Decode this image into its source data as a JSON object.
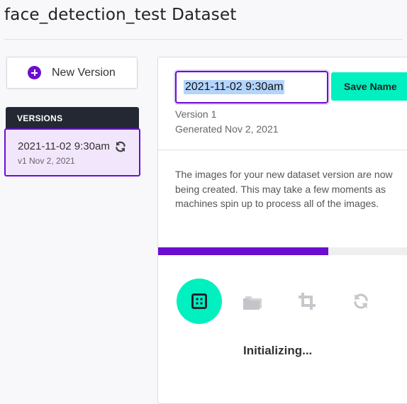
{
  "header": {
    "title": "face_detection_test Dataset"
  },
  "sidebar": {
    "new_version_button": {
      "label": "New Version",
      "icon": "plus-circle-icon"
    },
    "versions_header": "VERSIONS",
    "versions": [
      {
        "name": "2021-11-02 9:30am",
        "meta": "v1 Nov 2, 2021",
        "icon": "sync-icon",
        "selected": true
      }
    ]
  },
  "main": {
    "name_input": {
      "value": "2021-11-02 9:30am"
    },
    "save_name_button": "Save Name",
    "version_label": "Version 1",
    "generated_label": "Generated Nov 2, 2021",
    "description": "The images for your new dataset version are now being created. This may take a few moments as machines spin up to process all of the images.",
    "progress_fraction": 0.67,
    "steps": [
      {
        "icon": "grid-icon",
        "active": true
      },
      {
        "icon": "folder-icon",
        "active": false
      },
      {
        "icon": "crop-icon",
        "active": false
      },
      {
        "icon": "sync-icon",
        "active": false
      }
    ],
    "status": "Initializing..."
  },
  "colors": {
    "accent_purple": "#6b0fcf",
    "accent_teal": "#00f0c0",
    "selected_bg": "#f2e6fc",
    "header_dark": "#232833"
  }
}
